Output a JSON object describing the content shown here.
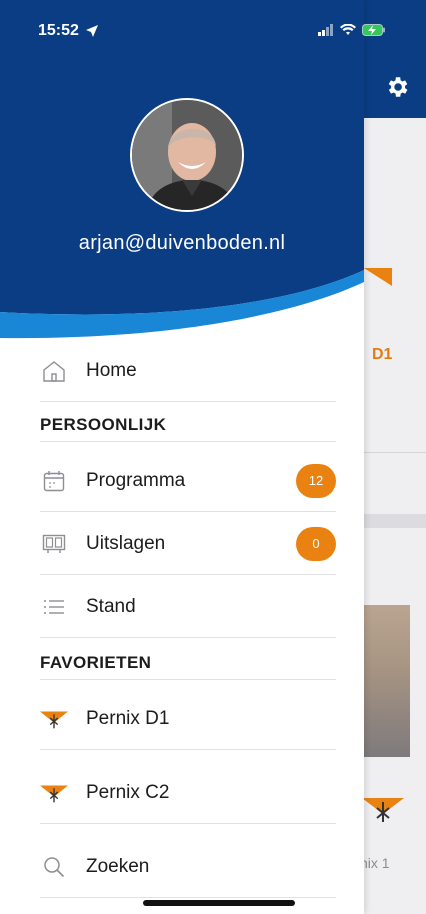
{
  "status_bar": {
    "time": "15:52"
  },
  "colors": {
    "brand_blue": "#0a3d84",
    "accent_orange": "#ea8211",
    "wave_light_blue": "#1a86d6"
  },
  "user": {
    "email": "arjan@duivenboden.nl"
  },
  "menu": {
    "home": {
      "label": "Home",
      "icon": "home-icon"
    },
    "section_personal": "PERSOONLIJK",
    "programma": {
      "label": "Programma",
      "badge": "12",
      "icon": "calendar-icon"
    },
    "uitslagen": {
      "label": "Uitslagen",
      "badge": "0",
      "icon": "results-board-icon"
    },
    "stand": {
      "label": "Stand",
      "icon": "list-icon"
    },
    "section_favorites": "FAVORIETEN",
    "fav1": {
      "label": "Pernix D1",
      "icon": "pernix-logo-icon"
    },
    "fav2": {
      "label": "Pernix C2",
      "icon": "pernix-logo-icon"
    },
    "search": {
      "label": "Zoeken",
      "icon": "search-icon"
    }
  },
  "background": {
    "team_label": "D1",
    "logo_caption": "nix 1"
  }
}
